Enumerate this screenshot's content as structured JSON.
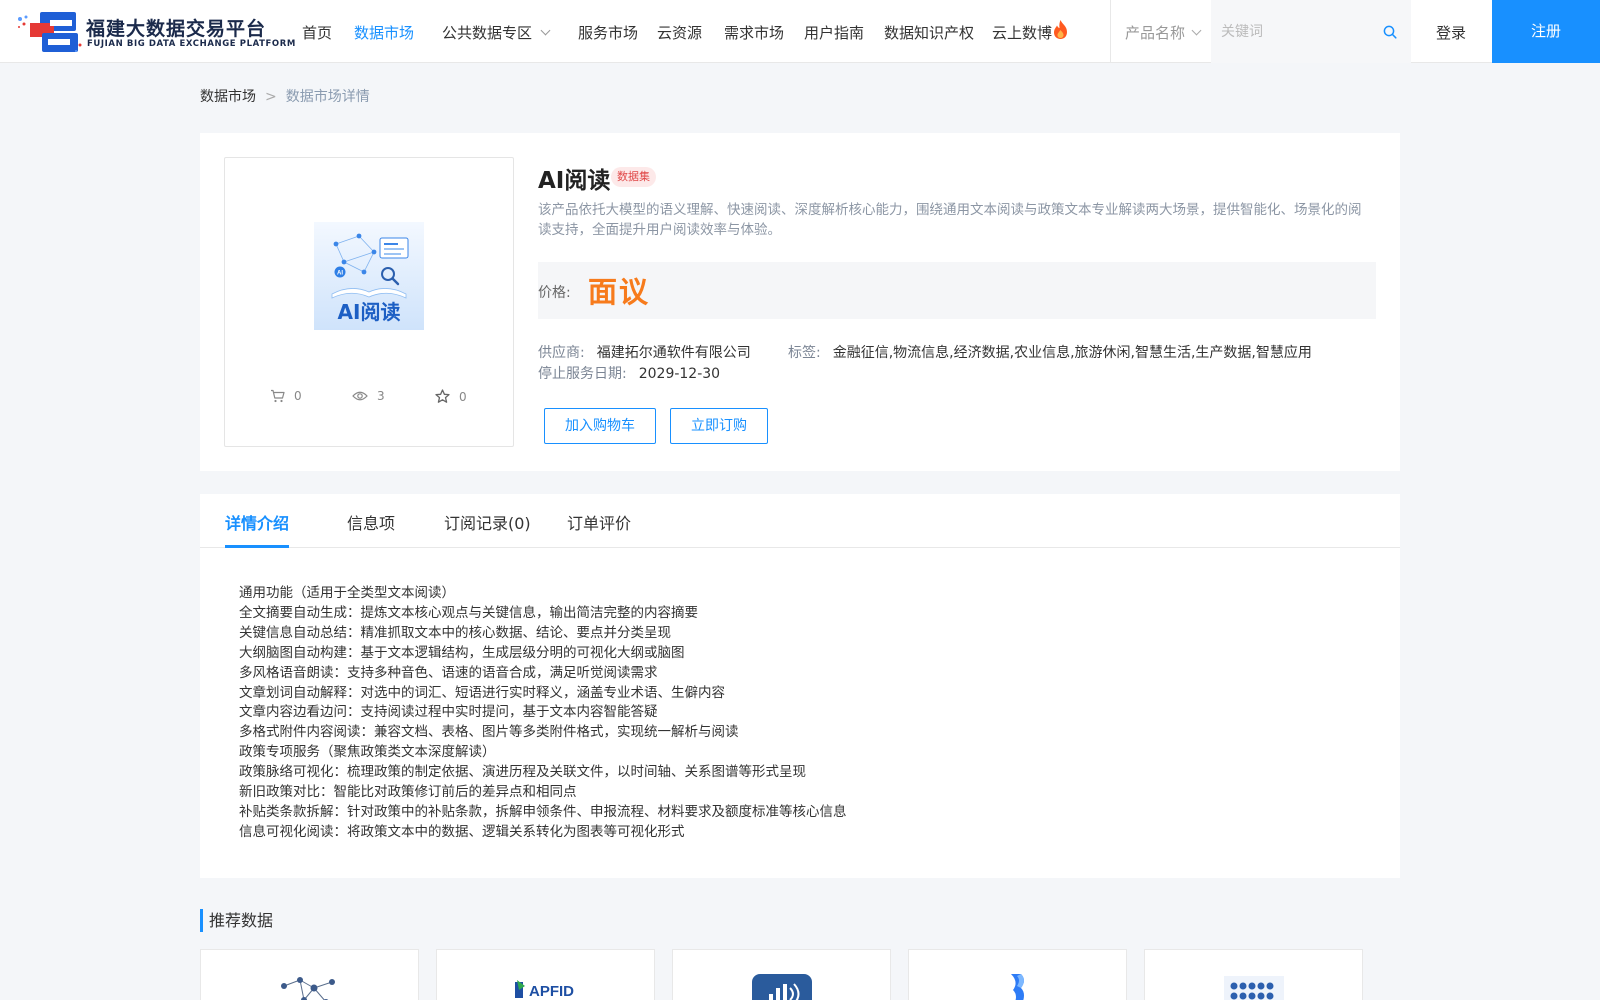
{
  "header": {
    "logo_title": "福建大数据交易平台",
    "logo_subtitle": "FUJIAN BIG DATA EXCHANGE PLATFORM",
    "nav": [
      {
        "label": "首页"
      },
      {
        "label": "数据市场",
        "active": true
      },
      {
        "label": "公共数据专区",
        "has_dropdown": true
      },
      {
        "label": "服务市场"
      },
      {
        "label": "云资源"
      },
      {
        "label": "需求市场"
      },
      {
        "label": "用户指南"
      },
      {
        "label": "数据知识产权"
      },
      {
        "label": "云上数博",
        "icon": "fire-icon"
      }
    ],
    "search": {
      "select_value": "产品名称",
      "placeholder": "关键词",
      "value": ""
    },
    "login_label": "登录",
    "register_label": "注册"
  },
  "breadcrumb": {
    "items": [
      "数据市场",
      "数据市场详情"
    ],
    "separator": ">"
  },
  "product": {
    "thumbnail_text": "AI阅读",
    "title": "AI阅读",
    "badge": "数据集",
    "description": "该产品依托大模型的语义理解、快速阅读、深度解析核心能力，围绕通用文本阅读与政策文本专业解读两大场景，提供智能化、场景化的阅读支持，全面提升用户阅读效率与体验。",
    "price_label": "价格:",
    "price_value": "面议",
    "supplier_label": "供应商:",
    "supplier_value": "福建拓尔通软件有限公司",
    "tags_label": "标签:",
    "tags_value": "金融征信,物流信息,经济数据,农业信息,旅游休闲,智慧生活,生产数据,智慧应用",
    "stop_date_label": "停止服务日期:",
    "stop_date_value": "2029-12-30",
    "stats": {
      "cart": "0",
      "views": "3",
      "favorites": "0"
    },
    "add_cart_label": "加入购物车",
    "subscribe_label": "立即订购"
  },
  "tabs": [
    {
      "label": "详情介绍",
      "active": true
    },
    {
      "label": "信息项"
    },
    {
      "label": "订阅记录(0)"
    },
    {
      "label": "订单评价"
    }
  ],
  "detail_lines": [
    "通用功能（适用于全类型文本阅读）",
    "全文摘要自动生成：提炼文本核心观点与关键信息，输出简洁完整的内容摘要",
    "关键信息自动总结：精准抓取文本中的核心数据、结论、要点并分类呈现",
    "大纲脑图自动构建：基于文本逻辑结构，生成层级分明的可视化大纲或脑图",
    "多风格语音朗读：支持多种音色、语速的语音合成，满足听觉阅读需求",
    "文章划词自动解释：对选中的词汇、短语进行实时释义，涵盖专业术语、生僻内容",
    "文章内容边看边问：支持阅读过程中实时提问，基于文本内容智能答疑",
    "多格式附件内容阅读：兼容文档、表格、图片等多类附件格式，实现统一解析与阅读",
    "政策专项服务（聚焦政策类文本深度解读）",
    "政策脉络可视化：梳理政策的制定依据、演进历程及关联文件，以时间轴、关系图谱等形式呈现",
    "新旧政策对比：智能比对政策修订前后的差异点和相同点",
    "补贴类条款拆解：针对政策中的补贴条款，拆解申领条件、申报流程、材料要求及额度标准等核心信息",
    "信息可视化阅读：将政策文本中的数据、逻辑关系转化为图表等可视化形式"
  ],
  "recommended": {
    "title": "推荐数据",
    "cards": [
      {
        "icon": "network-graph-icon"
      },
      {
        "icon": "apfid-logo-icon"
      },
      {
        "icon": "signal-chart-icon"
      },
      {
        "icon": "blue-ribbon-logo-icon"
      },
      {
        "icon": "dot-grid-logo-icon"
      }
    ]
  }
}
